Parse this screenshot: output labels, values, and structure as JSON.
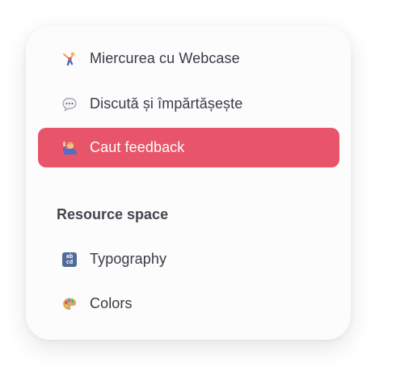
{
  "menu": {
    "items": [
      {
        "label": "Miercurea cu Webcase",
        "icon": "gymnast-icon"
      },
      {
        "label": "Discută și împărtășește",
        "icon": "speech-bubble-icon"
      },
      {
        "label": "Caut feedback",
        "icon": "raising-hand-person-icon",
        "active": true
      }
    ]
  },
  "resource_section": {
    "title": "Resource space",
    "items": [
      {
        "label": "Typography",
        "icon": "abcd-letters-icon",
        "icon_text_top": "ab",
        "icon_text_bottom": "cd"
      },
      {
        "label": "Colors",
        "icon": "artist-palette-icon"
      }
    ]
  },
  "colors": {
    "active_background": "#e8546a",
    "active_text": "#ffffff",
    "text": "#3a3a44"
  }
}
